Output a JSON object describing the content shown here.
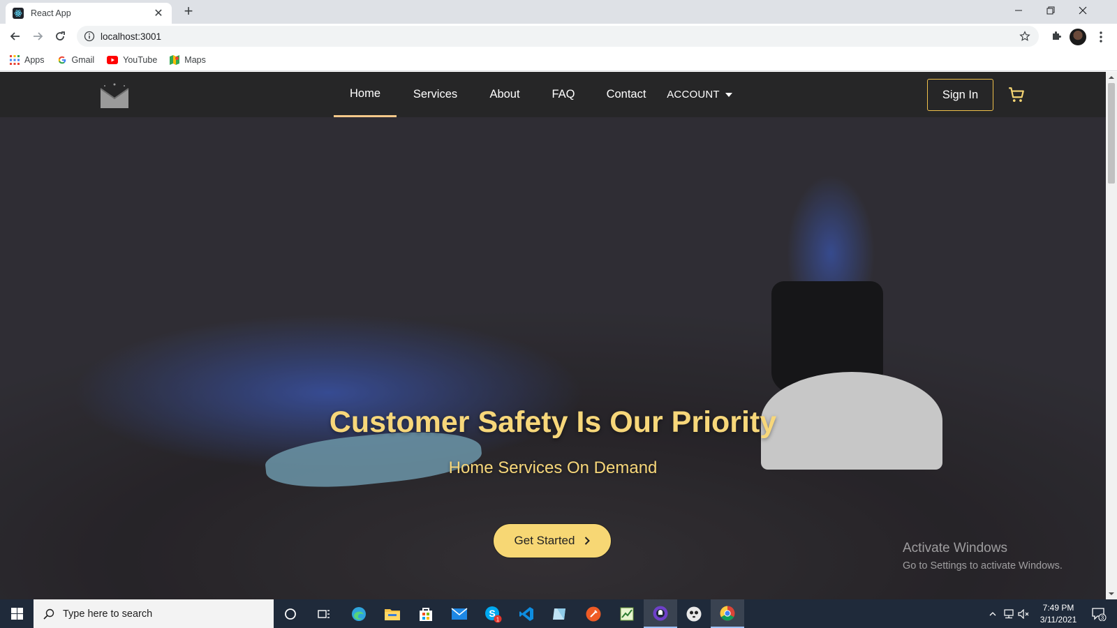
{
  "browser": {
    "tab": {
      "title": "React App",
      "close_glyph": "✕"
    },
    "new_tab_glyph": "+",
    "address": {
      "url": "localhost:3001"
    },
    "bookmarks": [
      {
        "label": "Apps",
        "icon": "apps-grid-icon"
      },
      {
        "label": "Gmail",
        "icon": "google-icon"
      },
      {
        "label": "YouTube",
        "icon": "youtube-icon"
      },
      {
        "label": "Maps",
        "icon": "maps-icon"
      }
    ]
  },
  "site": {
    "nav": {
      "links": [
        {
          "label": "Home",
          "active": true
        },
        {
          "label": "Services"
        },
        {
          "label": "About"
        },
        {
          "label": "FAQ"
        },
        {
          "label": "Contact"
        }
      ],
      "account_label": "ACCOUNT",
      "signin_label": "Sign In"
    },
    "hero": {
      "title": "Customer Safety Is Our Priority",
      "subtitle": "Home Services On Demand",
      "cta_label": "Get Started"
    }
  },
  "windows": {
    "watermark_title": "Activate Windows",
    "watermark_subtitle": "Go to Settings to activate Windows.",
    "search_placeholder": "Type here to search",
    "time": "7:49 PM",
    "date": "3/11/2021",
    "skype_badge": "1",
    "notifications_count": "3"
  },
  "colors": {
    "accent_yellow": "#f7d774",
    "nav_bg": "#262626",
    "taskbar_bg": "#1f2a3a"
  }
}
